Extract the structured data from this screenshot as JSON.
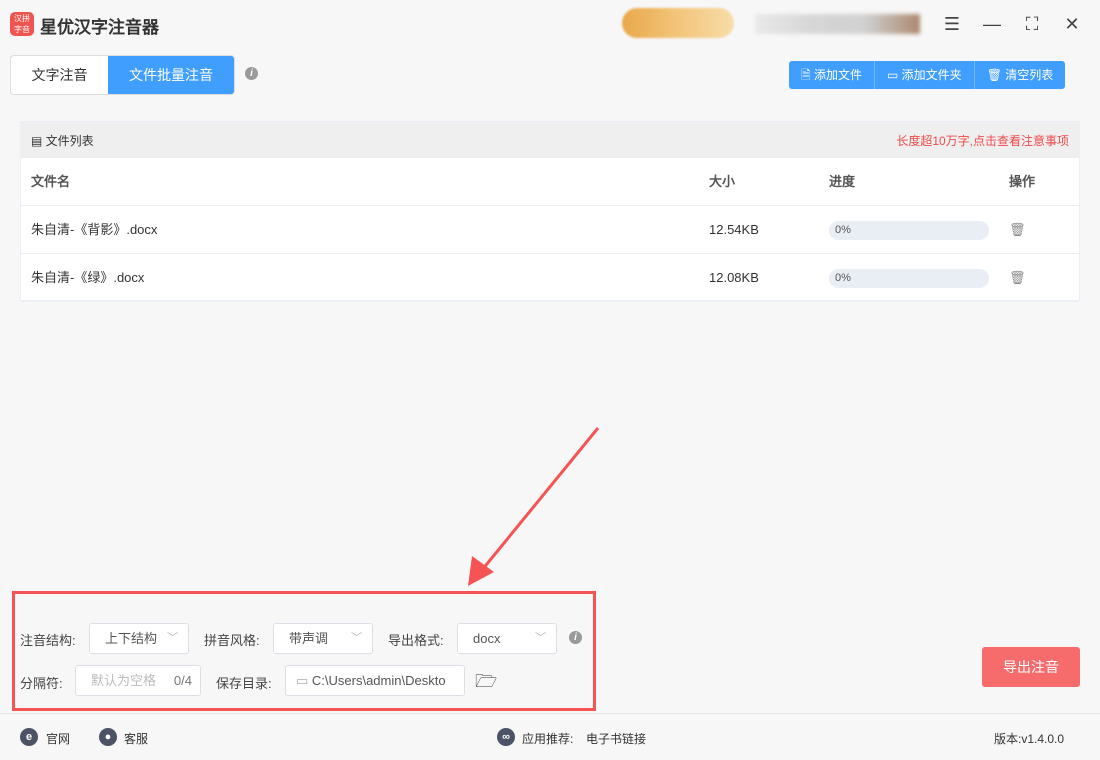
{
  "app": {
    "title": "星优汉字注音器",
    "logo_text": "汉拼字音"
  },
  "tabs": [
    {
      "label": "文字注音"
    },
    {
      "label": "文件批量注音"
    }
  ],
  "toolbar": {
    "add_file": "添加文件",
    "add_folder": "添加文件夹",
    "clear_list": "清空列表"
  },
  "file_list": {
    "title": "文件列表",
    "warning": "长度超10万字,点击查看注意事项",
    "columns": [
      "文件名",
      "大小",
      "进度",
      "操作"
    ],
    "rows": [
      {
        "name": "朱自清-《背影》.docx",
        "size": "12.54KB",
        "progress": "0%"
      },
      {
        "name": "朱自清-《绿》.docx",
        "size": "12.08KB",
        "progress": "0%"
      }
    ]
  },
  "options": {
    "structure_label": "注音结构:",
    "structure_value": "上下结构",
    "style_label": "拼音风格:",
    "style_value": "带声调",
    "format_label": "导出格式:",
    "format_value": "docx",
    "separator_label": "分隔符:",
    "separator_placeholder": "默认为空格",
    "separator_count": "0/4",
    "save_label": "保存目录:",
    "save_value": "C:\\Users\\admin\\Deskto"
  },
  "export_button": "导出注音",
  "footer": {
    "website": "官网",
    "support": "客服",
    "recommend_label": "应用推荐:",
    "recommend_link": "电子书链接",
    "version": "版本:v1.4.0.0"
  },
  "colors": {
    "primary": "#409eff",
    "export": "#f66b6b",
    "highlight": "#f65454"
  }
}
